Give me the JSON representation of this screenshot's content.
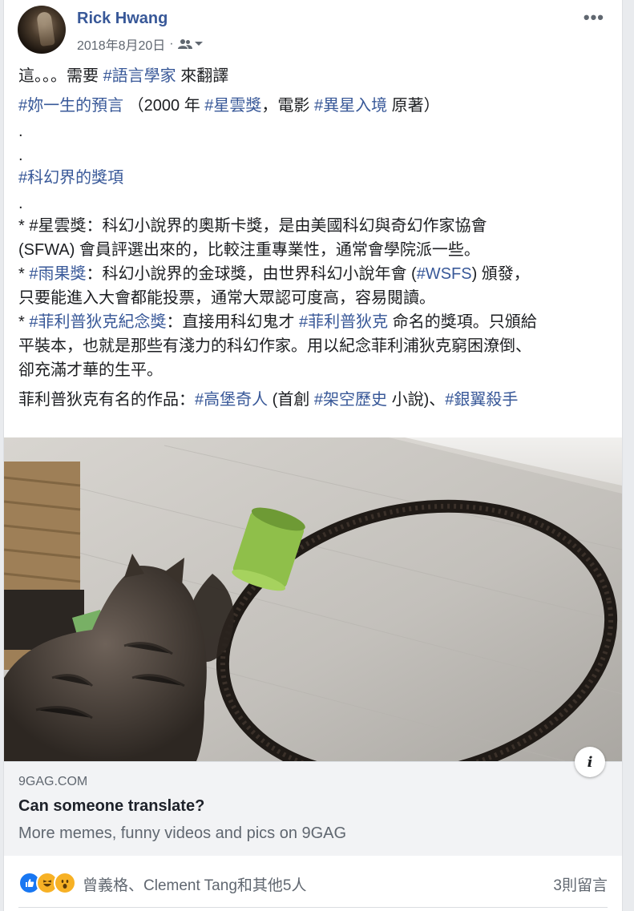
{
  "post": {
    "author": "Rick Hwang",
    "date": "2018年8月20日",
    "separator": "·",
    "more_label": "•••",
    "icons": {
      "audience": "friends-icon",
      "dropdown": "caret-down-icon",
      "more": "more-options-icon"
    }
  },
  "body": {
    "l1a": "這。。。需要 ",
    "l1tag": "#語言學家",
    "l1b": " 來翻譯",
    "l2tag": "#妳一生的預言",
    "l2a": " （2000 年 ",
    "l2tag2": "#星雲獎",
    "l2b": "，電影 ",
    "l2tag3": "#異星入境",
    "l2c": " 原著）",
    "dot": ".",
    "l3tag": "#科幻界的獎項",
    "b1a": "* #星雲獎：科幻小說界的奧斯卡獎，是由美國科幻與奇幻作家協會",
    "b1b": "(SFWA) 會員評選出來的，比較注重專業性，通常會學院派一些。",
    "b2pre": "* ",
    "b2tag": "#雨果獎",
    "b2a": "：科幻小說界的金球獎，由世界科幻小說年會 (",
    "b2tag2": "#WSFS",
    "b2b": ") 頒發，",
    "b2c": "只要能進入大會都能投票，通常大眾認可度高，容易閱讀。",
    "b3pre": "* ",
    "b3tag": "#菲利普狄克紀念獎",
    "b3a": "：直接用科幻鬼才 ",
    "b3tag2": "#菲利普狄克",
    "b3b": " 命名的獎項。只頒給",
    "b3c": "平裝本，也就是那些有淺力的科幻作家。用以紀念菲利浦狄克窮困潦倒、",
    "b3d": "卻充滿才華的生平。",
    "l5a": "菲利普狄克有名的作品：",
    "l5tag": "#高堡奇人",
    "l5b": " (首創 ",
    "l5tag2": "#架空歷史",
    "l5c": " 小說)、",
    "l5tag3": "#銀翼殺手"
  },
  "link": {
    "domain": "9GAG.COM",
    "title": "Can someone translate?",
    "description": "More memes, funny videos and pics on 9GAG",
    "info": "i"
  },
  "footer": {
    "reactions": [
      "like",
      "haha",
      "wow"
    ],
    "reactors": "曾義格、Clement Tang和其他5人",
    "comments": "3則留言"
  },
  "colors": {
    "link": "#385898",
    "brand_blue": "#1877f2",
    "background": "#e9ebee"
  }
}
